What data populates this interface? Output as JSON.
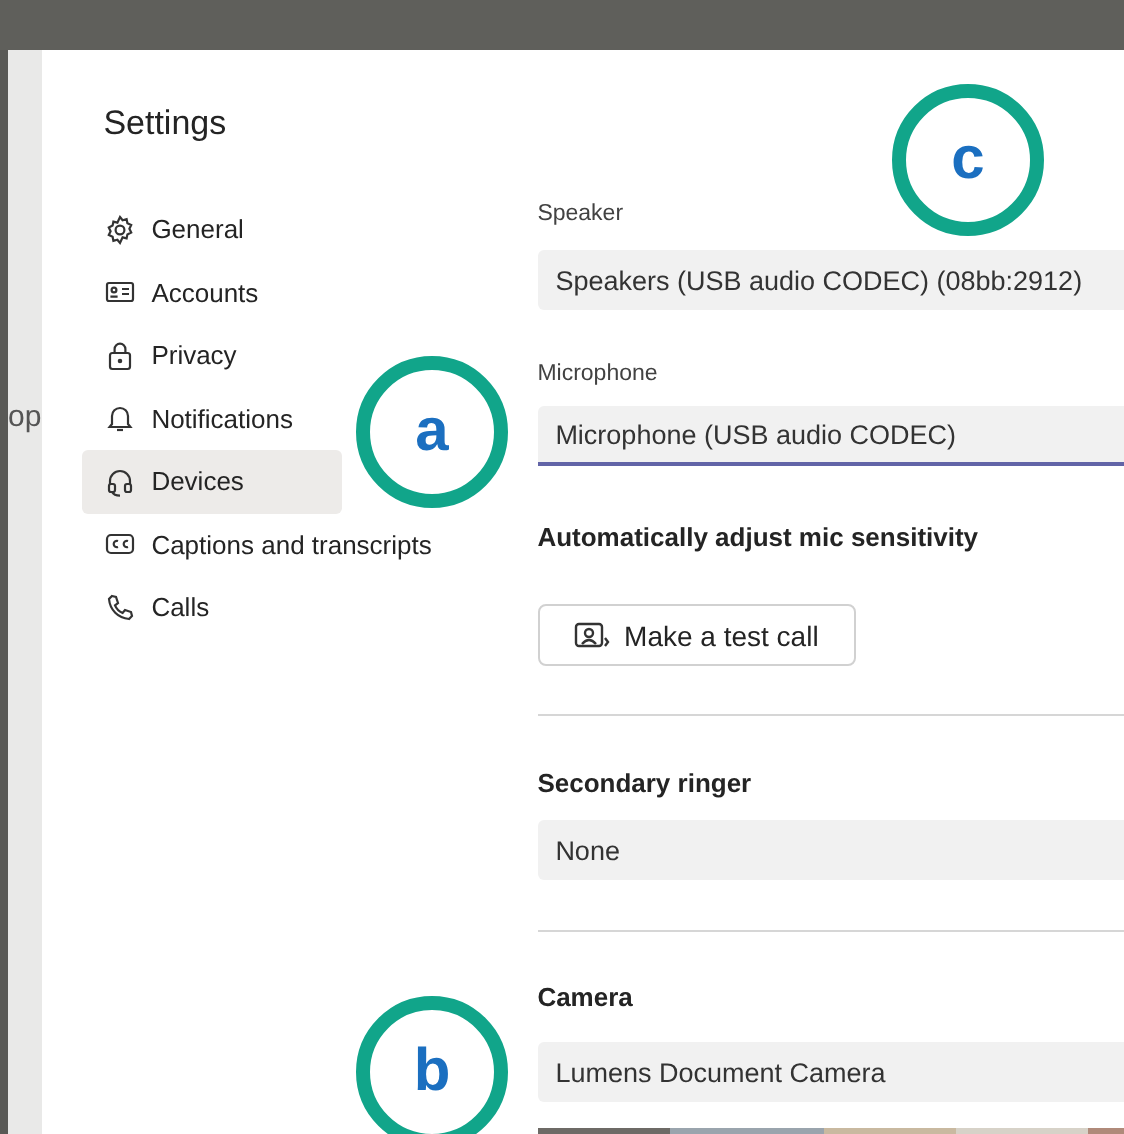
{
  "background_text": "op",
  "dialog": {
    "title": "Settings"
  },
  "nav": [
    {
      "label": "General",
      "selected": false
    },
    {
      "label": "Accounts",
      "selected": false
    },
    {
      "label": "Privacy",
      "selected": false
    },
    {
      "label": "Notifications",
      "selected": false
    },
    {
      "label": "Devices",
      "selected": true
    },
    {
      "label": "Captions and transcripts",
      "selected": false
    },
    {
      "label": "Calls",
      "selected": false
    }
  ],
  "speaker": {
    "label": "Speaker",
    "value": "Speakers (USB audio CODEC) (08bb:2912)",
    "focused": false
  },
  "microphone": {
    "label": "Microphone",
    "value": "Microphone (USB audio CODEC)",
    "focused": true
  },
  "auto_adjust": {
    "heading": "Automatically adjust mic sensitivity"
  },
  "test_call_button": "Make a test call",
  "secondary_ringer": {
    "heading": "Secondary ringer",
    "value": "None",
    "focused": false
  },
  "camera": {
    "heading": "Camera",
    "value": "Lumens Document Camera",
    "focused": false
  },
  "annotations": [
    {
      "label": "a"
    },
    {
      "label": "c"
    },
    {
      "label": "b"
    }
  ]
}
